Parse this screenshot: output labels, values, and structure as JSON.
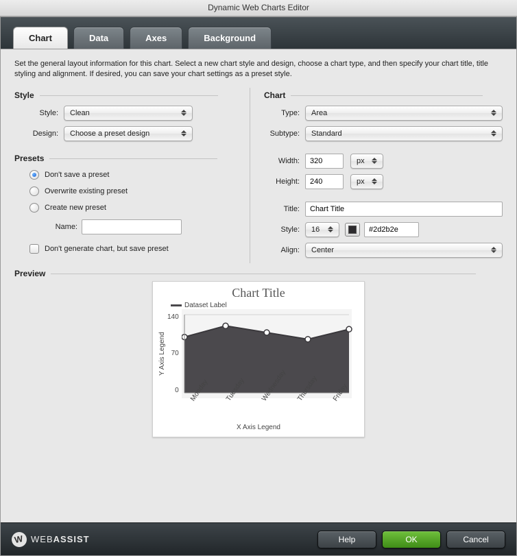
{
  "window": {
    "title": "Dynamic Web Charts Editor"
  },
  "tabs": [
    "Chart",
    "Data",
    "Axes",
    "Background"
  ],
  "active_tab": "Chart",
  "intro": "Set the general layout information for this chart. Select a new chart style and design, choose a chart type, and then specify your chart title, title styling and alignment. If desired, you can save your chart settings as a preset style.",
  "style_section": {
    "heading": "Style",
    "style_label": "Style:",
    "style_value": "Clean",
    "design_label": "Design:",
    "design_value": "Choose a preset design"
  },
  "presets_section": {
    "heading": "Presets",
    "opt_no_save": "Don't save a preset",
    "opt_overwrite": "Overwrite existing preset",
    "opt_create": "Create new preset",
    "name_label": "Name:",
    "name_value": "",
    "dont_generate": "Don't generate chart, but save preset"
  },
  "chart_section": {
    "heading": "Chart",
    "type_label": "Type:",
    "type_value": "Area",
    "subtype_label": "Subtype:",
    "subtype_value": "Standard",
    "width_label": "Width:",
    "width_value": "320",
    "width_unit": "px",
    "height_label": "Height:",
    "height_value": "240",
    "height_unit": "px",
    "title_label": "Title:",
    "title_value": "Chart Title",
    "tstyle_label": "Style:",
    "tstyle_size": "16",
    "tstyle_color": "#2d2b2e",
    "align_label": "Align:",
    "align_value": "Center"
  },
  "preview": {
    "heading": "Preview",
    "chart_title": "Chart Title",
    "legend_label": "Dataset Label",
    "ylabel": "Y Axis Legend",
    "xlabel": "X Axis Legend",
    "yticks": [
      "140",
      "70",
      "0"
    ],
    "xticks": [
      "Monday",
      "Tuesday",
      "Wednesday",
      "Thursday",
      "Friday"
    ]
  },
  "footer": {
    "brand1": "WEB",
    "brand2": "ASSIST",
    "help": "Help",
    "ok": "OK",
    "cancel": "Cancel"
  },
  "chart_data": {
    "type": "area",
    "categories": [
      "Monday",
      "Tuesday",
      "Wednesday",
      "Thursday",
      "Friday"
    ],
    "values": [
      100,
      120,
      108,
      96,
      114
    ],
    "title": "Chart Title",
    "xlabel": "X Axis Legend",
    "ylabel": "Y Axis Legend",
    "ylim": [
      0,
      140
    ],
    "legend": [
      "Dataset Label"
    ]
  }
}
